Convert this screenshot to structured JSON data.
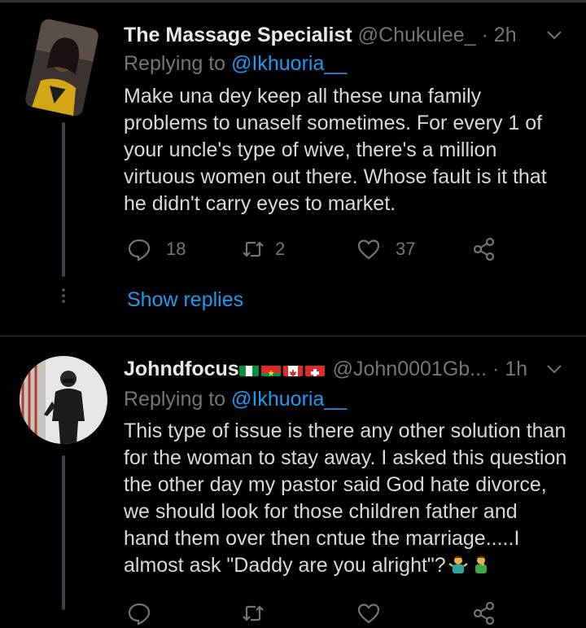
{
  "tweets": [
    {
      "display_name": "The Massage Specialist",
      "handle": "@Chukulee_",
      "separator": "·",
      "time": "2h",
      "replying_prefix": "Replying to",
      "replying_to": "@Ikhuoria__",
      "text": "Make una dey keep all these una family problems to unaself sometimes. For every 1 of your uncle's type of wive, there's a million virtuous women out there. Whose fault is it that he didn't carry eyes to market.",
      "reply_count": "18",
      "retweet_count": "2",
      "like_count": "37",
      "show_replies": "Show replies"
    },
    {
      "display_name": "Johndfocus",
      "flags": [
        "nigeria-flag",
        "burkina-faso-flag",
        "canada-flag",
        "switzerland-flag"
      ],
      "handle": "@John0001Gb...",
      "separator": "·",
      "time": "1h",
      "replying_prefix": "Replying to",
      "replying_to": "@Ikhuoria__",
      "text": "This type of issue is there any other solution than for the woman to stay away. I asked this question the other day my pastor said God hate divorce, we should look for those children father and hand them over then cntue the marriage.....I almost ask \"Daddy are you alright\"?",
      "emojis": [
        "man-shrugging-emoji",
        "man-facepalming-emoji"
      ]
    }
  ],
  "colors": {
    "background": "#000000",
    "text": "#d9d9d9",
    "muted": "#71767b",
    "link": "#1d9bf0",
    "divider": "#2f3336"
  },
  "icons": [
    "reply-icon",
    "retweet-icon",
    "like-icon",
    "share-icon",
    "chevron-down-icon"
  ]
}
